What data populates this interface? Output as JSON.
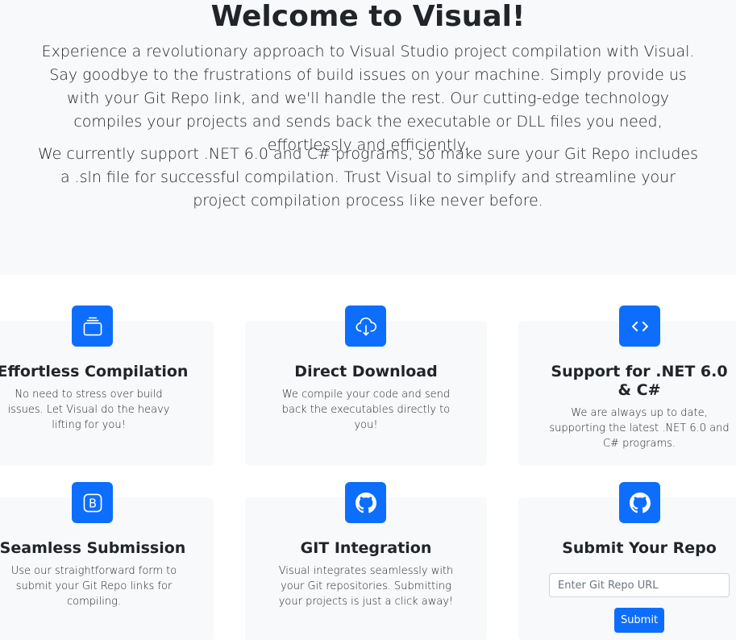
{
  "hero": {
    "title": "Welcome to Visual!",
    "paragraph1": "Experience a revolutionary approach to Visual Studio project compilation with Visual. Say goodbye to the frustrations of build issues on your machine. Simply provide us with your Git Repo link, and we'll handle the rest. Our cutting-edge technology compiles your projects and sends back the executable or DLL files you need, effortlessly and efficiently.",
    "paragraph2": "We currently support .NET 6.0 and C# programs, so make sure your Git Repo includes a .sln file for successful compilation. Trust Visual to simplify and streamline your project compilation process like never before."
  },
  "features": [
    {
      "icon": "collection-icon",
      "title": "Effortless Compilation",
      "description": "No need to stress over build issues. Let Visual do the heavy lifting for you!"
    },
    {
      "icon": "cloud-download-icon",
      "title": "Direct Download",
      "description": "We compile your code and send back the executables directly to you!"
    },
    {
      "icon": "code-icon",
      "title": "Support for .NET 6.0 & C#",
      "description": "We are always up to date, supporting the latest .NET 6.0 and C# programs."
    },
    {
      "icon": "bootstrap-icon",
      "title": "Seamless Submission",
      "description": "Use our straightforward form to submit your Git Repo links for compiling."
    },
    {
      "icon": "github-icon",
      "title": "GIT Integration",
      "description": "Visual integrates seamlessly with your Git repositories. Submitting your projects is just a click away!"
    }
  ],
  "submit_form": {
    "icon": "github-icon",
    "title": "Submit Your Repo",
    "input_placeholder": "Enter Git Repo URL",
    "input_value": "",
    "button_label": "Submit"
  },
  "colors": {
    "accent": "#0d6efd",
    "card_background": "#f8f9fa",
    "text": "#212529"
  }
}
